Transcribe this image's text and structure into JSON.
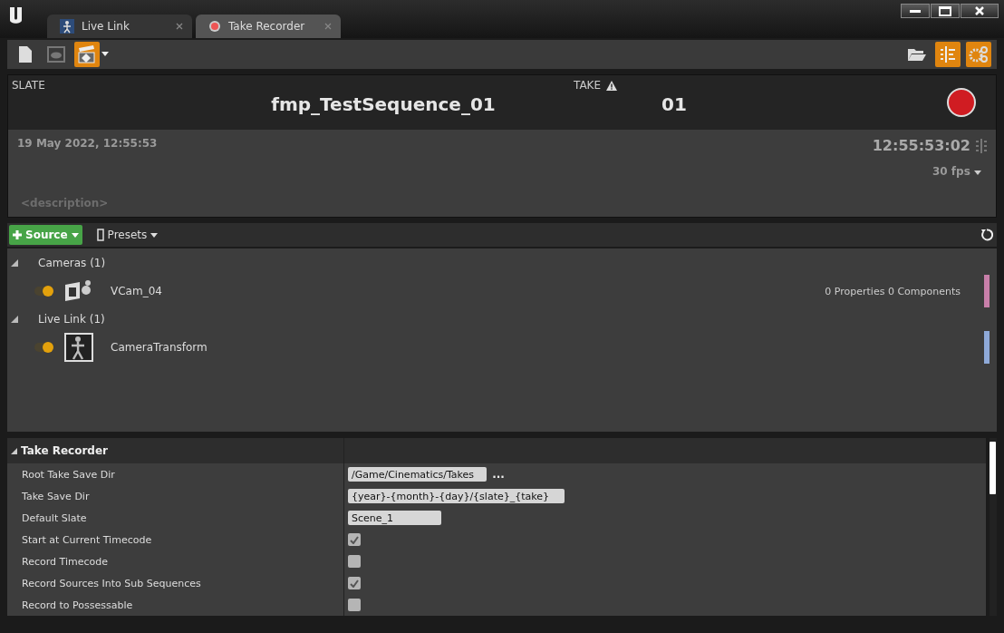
{
  "tabs": [
    {
      "label": "Live Link",
      "selected": false,
      "kind": "livelink"
    },
    {
      "label": "Take Recorder",
      "selected": true,
      "kind": "record"
    }
  ],
  "toolbar": {
    "left": [
      {
        "kind": "file",
        "on": false
      },
      {
        "kind": "preview",
        "on": false
      },
      {
        "kind": "clapper",
        "on": true
      }
    ],
    "right": [
      {
        "kind": "folder",
        "on": false
      },
      {
        "kind": "sources",
        "on": true
      },
      {
        "kind": "settings",
        "on": true
      }
    ]
  },
  "slate": {
    "label": "SLATE",
    "value": "fmp_TestSequence_01"
  },
  "take": {
    "label": "TAKE",
    "value": "01"
  },
  "timestamp": "19 May 2022, 12:55:53",
  "timecode": "12:55:53:02",
  "frame_rate": "30 fps",
  "description": {
    "placeholder": "<description>"
  },
  "sources": {
    "add_button": "Source",
    "presets": "Presets",
    "groups": [
      {
        "label": "Cameras (1)",
        "expanded": true,
        "children": [
          {
            "name": "VCam_04",
            "kind": "camera",
            "enabled": true,
            "info": "0 Properties 0 Components",
            "color": "#c87fa9"
          }
        ]
      },
      {
        "label": "Live Link (1)",
        "expanded": true,
        "children": [
          {
            "name": "CameraTransform",
            "kind": "livelink",
            "enabled": true,
            "color": "#8fa9d8"
          }
        ]
      }
    ]
  },
  "details": {
    "title": "Take Recorder",
    "expanded": true,
    "rows": [
      {
        "label": "Root Take Save Dir",
        "kind": "text",
        "value": "/Game/Cinematics/Takes",
        "browse": "..."
      },
      {
        "label": "Take Save Dir",
        "kind": "text",
        "value": "{year}-{month}-{day}/{slate}_{take}"
      },
      {
        "label": "Default Slate",
        "kind": "text",
        "value": "Scene_1"
      },
      {
        "label": "Start at Current Timecode",
        "kind": "checkbox",
        "checked": true
      },
      {
        "label": "Record Timecode",
        "kind": "checkbox",
        "checked": false
      },
      {
        "label": "Record Sources Into Sub Sequences",
        "kind": "checkbox",
        "checked": true
      },
      {
        "label": "Record to Possessable",
        "kind": "checkbox",
        "checked": false
      }
    ]
  }
}
